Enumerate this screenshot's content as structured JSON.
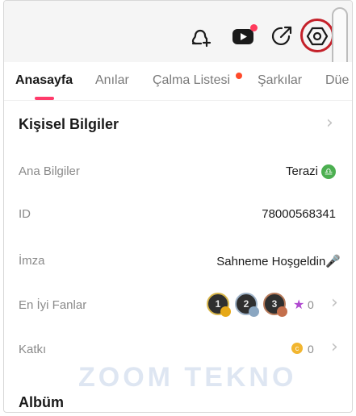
{
  "toolbar": {
    "icons": [
      "add-friend-icon",
      "live-video-icon",
      "share-icon",
      "settings-icon"
    ]
  },
  "tabs": [
    {
      "label": "Anasayfa",
      "active": true
    },
    {
      "label": "Anılar",
      "active": false
    },
    {
      "label": "Çalma Listesi",
      "active": false,
      "has_dot": true
    },
    {
      "label": "Şarkılar",
      "active": false
    },
    {
      "label": "Düe",
      "active": false
    }
  ],
  "personal": {
    "title": "Kişisel Bilgiler",
    "rows": {
      "basic": {
        "label": "Ana Bilgiler",
        "value": "Terazi"
      },
      "id": {
        "label": "ID",
        "value": "78000568341"
      },
      "signature": {
        "label": "İmza",
        "value": "Sahneme Hoşgeldin🎤"
      },
      "top_fans": {
        "label": "En İyi Fanlar",
        "count": "0",
        "ranks": [
          "1",
          "2",
          "3"
        ]
      },
      "contribution": {
        "label": "Katkı",
        "count": "0"
      }
    }
  },
  "album": {
    "title": "Albüm"
  },
  "watermark": {
    "text": "ZOOM TEKNO"
  },
  "colors": {
    "accent": "#ff3b6b",
    "annotation_ring": "#c4212a",
    "zodiac_badge": "#4caf50",
    "coin": "#f2b630"
  }
}
